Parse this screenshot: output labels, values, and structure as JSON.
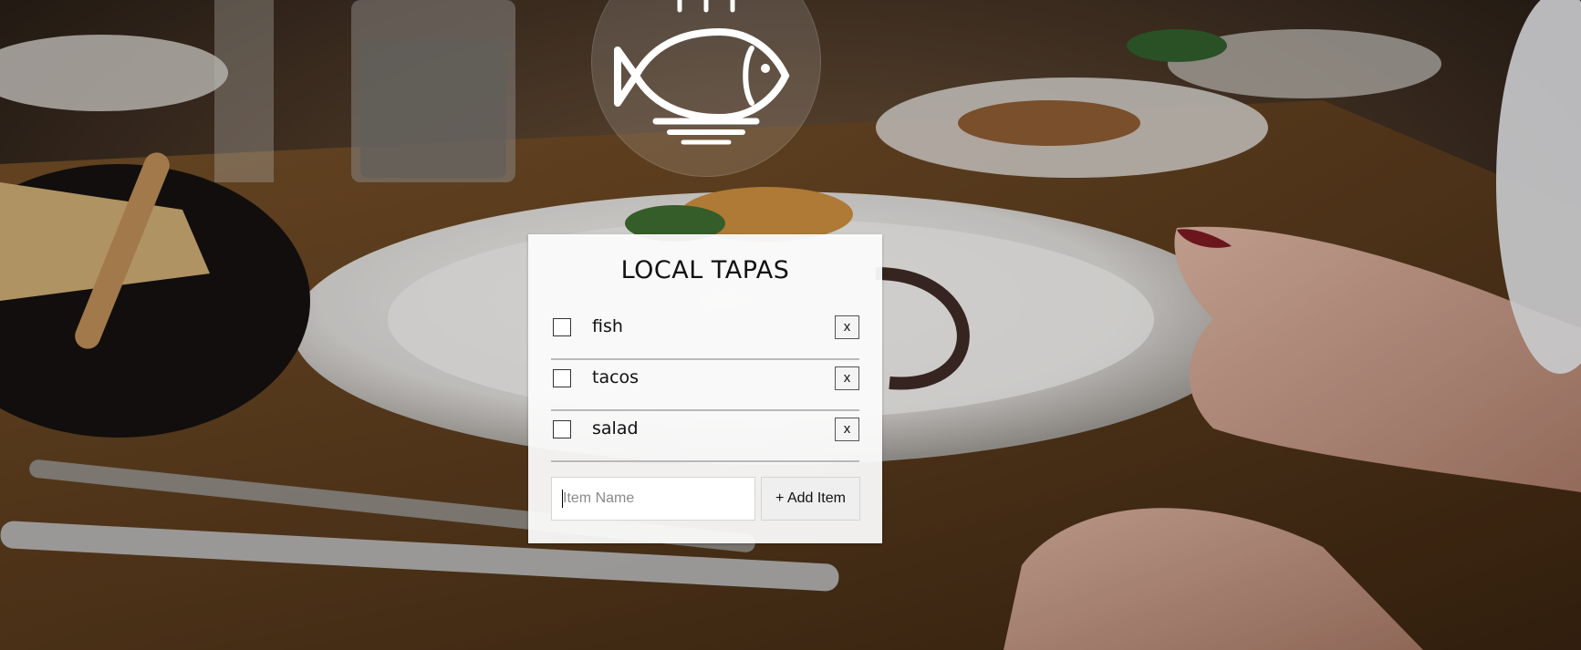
{
  "background": {
    "icon": "restaurant-table-photo"
  },
  "logo": {
    "icon": "fish-on-plate-icon"
  },
  "card": {
    "title": "LOCAL TAPAS"
  },
  "items": [
    {
      "label": "fish",
      "checked": false,
      "delete_label": "x"
    },
    {
      "label": "tacos",
      "checked": false,
      "delete_label": "x"
    },
    {
      "label": "salad",
      "checked": false,
      "delete_label": "x"
    }
  ],
  "form": {
    "value": "",
    "placeholder": "Item Name",
    "add_label": "+ Add Item"
  }
}
